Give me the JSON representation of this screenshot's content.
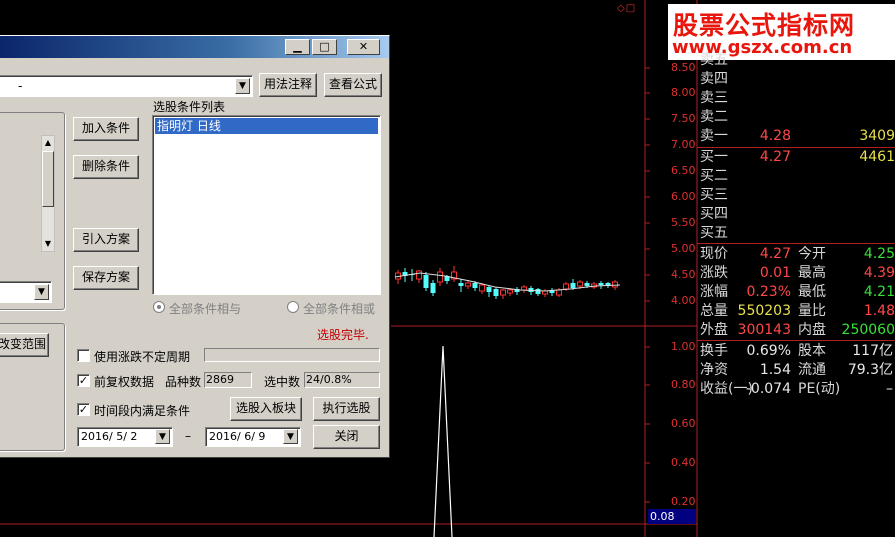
{
  "chart": {
    "top_markers": "◇□",
    "price_ticks": [
      "8.50",
      "8.00",
      "7.50",
      "7.00",
      "6.50",
      "6.00",
      "5.50",
      "5.00",
      "4.50",
      "4.00"
    ],
    "indicator_ticks": [
      "1.00",
      "0.80",
      "0.60",
      "0.40",
      "0.20"
    ],
    "current_value": "0.08"
  },
  "watermark": {
    "line1": "股票公式指标网",
    "line2": "www.gszx.com.cn"
  },
  "quote": {
    "asks": [
      {
        "name": "卖五",
        "price": "",
        "vol": ""
      },
      {
        "name": "卖四",
        "price": "",
        "vol": ""
      },
      {
        "name": "卖三",
        "price": "",
        "vol": ""
      },
      {
        "name": "卖二",
        "price": "",
        "vol": ""
      },
      {
        "name": "卖一",
        "price": "4.28",
        "vol": "3409"
      }
    ],
    "bids": [
      {
        "name": "买一",
        "price": "4.27",
        "vol": "4461"
      },
      {
        "name": "买二",
        "price": "",
        "vol": ""
      },
      {
        "name": "买三",
        "price": "",
        "vol": ""
      },
      {
        "name": "买四",
        "price": "",
        "vol": ""
      },
      {
        "name": "买五",
        "price": "",
        "vol": ""
      }
    ],
    "stats": [
      {
        "l1": "现价",
        "v1": "4.27",
        "c1": "red",
        "l2": "今开",
        "v2": "4.25",
        "c2": "green"
      },
      {
        "l1": "涨跌",
        "v1": "0.01",
        "c1": "red",
        "l2": "最高",
        "v2": "4.39",
        "c2": "red"
      },
      {
        "l1": "涨幅",
        "v1": "0.23%",
        "c1": "red",
        "l2": "最低",
        "v2": "4.21",
        "c2": "green"
      },
      {
        "l1": "总量",
        "v1": "550203",
        "c1": "yellow",
        "l2": "量比",
        "v2": "1.48",
        "c2": "red"
      },
      {
        "l1": "外盘",
        "v1": "300143",
        "c1": "red",
        "l2": "内盘",
        "v2": "250060",
        "c2": "green"
      }
    ],
    "stats2": [
      {
        "l1": "换手",
        "v1": "0.69%",
        "l2": "股本",
        "v2": "117亿"
      },
      {
        "l1": "净资",
        "v1": "1.54",
        "l2": "流通",
        "v2": "79.3亿"
      },
      {
        "l1": "收益(一)",
        "v1": "-0.074",
        "l2": "PE(动)",
        "v2": "–"
      }
    ]
  },
  "dialog": {
    "minimize": "▁",
    "restore": "□",
    "close": "✕",
    "condition_combo": "-",
    "usage_button": "用法注释",
    "view_formula_button": "查看公式",
    "list_title": "选股条件列表",
    "list_items": [
      "指明灯  日线"
    ],
    "add_condition": "加入条件",
    "delete_condition": "删除条件",
    "import_plan": "引入方案",
    "save_plan": "保存方案",
    "radio_and": "全部条件相与",
    "radio_or": "全部条件相或",
    "status": "选股完毕.",
    "change_range": "改变范围",
    "chk_uncertain_period": "使用涨跌不定周期",
    "chk_pre_adjust": "前复权数据",
    "variety_label": "品种数",
    "variety_count": "2869",
    "selected_label": "选中数",
    "selected_count": "24/0.8%",
    "chk_time_range": "时间段内满足条件",
    "select_to_board": "选股入板块",
    "execute": "执行选股",
    "close_button": "关闭",
    "date_from": "2016/ 5/ 2",
    "date_to": "2016/ 6/ 9",
    "date_sep": "–",
    "chk_uncertain_period_checked": false,
    "chk_pre_adjust_checked": true,
    "chk_time_range_checked": true
  }
}
